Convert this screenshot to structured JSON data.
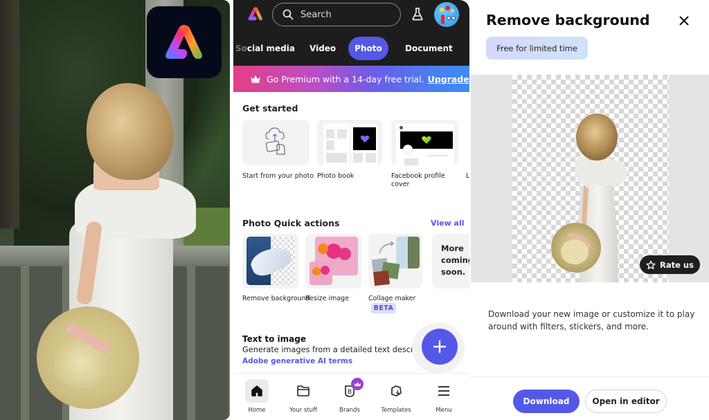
{
  "left_photo": {
    "description": "woman in white dress holding straw hat on porch",
    "app_icon": "adobe-express-logo"
  },
  "phone": {
    "header": {
      "search_placeholder": "Search",
      "icons": [
        "adobe-express-logo-icon",
        "search-icon",
        "flask-icon",
        "avatar"
      ]
    },
    "tabs": [
      {
        "label_faded": "So",
        "label": "cial media",
        "active": false
      },
      {
        "label": "Video",
        "active": false
      },
      {
        "label": "Photo",
        "active": true
      },
      {
        "label": "Document",
        "active": false
      }
    ],
    "premium_banner": {
      "text": "Go Premium with a 14-day free trial.",
      "link": "Upgrade"
    },
    "get_started": {
      "title": "Get started",
      "cards": [
        {
          "label": "Start from your photo"
        },
        {
          "label": "Photo book"
        },
        {
          "label": "Facebook profile cover"
        },
        {
          "label": "L"
        }
      ]
    },
    "quick_actions": {
      "title": "Photo Quick actions",
      "view_all": "View all",
      "items": [
        {
          "label": "Remove background"
        },
        {
          "label": "Resize image"
        },
        {
          "label": "Collage maker",
          "badge": "BETA"
        },
        {
          "label": "More coming soon."
        }
      ]
    },
    "text_to_image": {
      "title": "Text to image",
      "description": "Generate images from a detailed text description",
      "link": "Adobe generative AI terms"
    },
    "fab": {
      "icon": "plus-icon"
    },
    "bottom_nav": [
      {
        "label": "Home",
        "icon": "home-icon",
        "active": true
      },
      {
        "label": "Your stuff",
        "icon": "folder-icon",
        "active": false
      },
      {
        "label": "Brands",
        "icon": "brand-icon",
        "active": false,
        "badge": "crown-icon"
      },
      {
        "label": "Templates",
        "icon": "templates-icon",
        "active": false
      },
      {
        "label": "Menu",
        "icon": "menu-icon",
        "active": false
      }
    ]
  },
  "remove_bg": {
    "title": "Remove background",
    "badge": "Free for limited time",
    "rate_us": "Rate us",
    "description": "Download your new image or customize it to play around with filters, stickers, and more.",
    "download_button": "Download",
    "open_editor_button": "Open in editor"
  },
  "colors": {
    "accent": "#5458e6",
    "dark_header": "#1d1d1d",
    "banner_start": "#e53f86",
    "banner_end": "#3d8cf2"
  }
}
